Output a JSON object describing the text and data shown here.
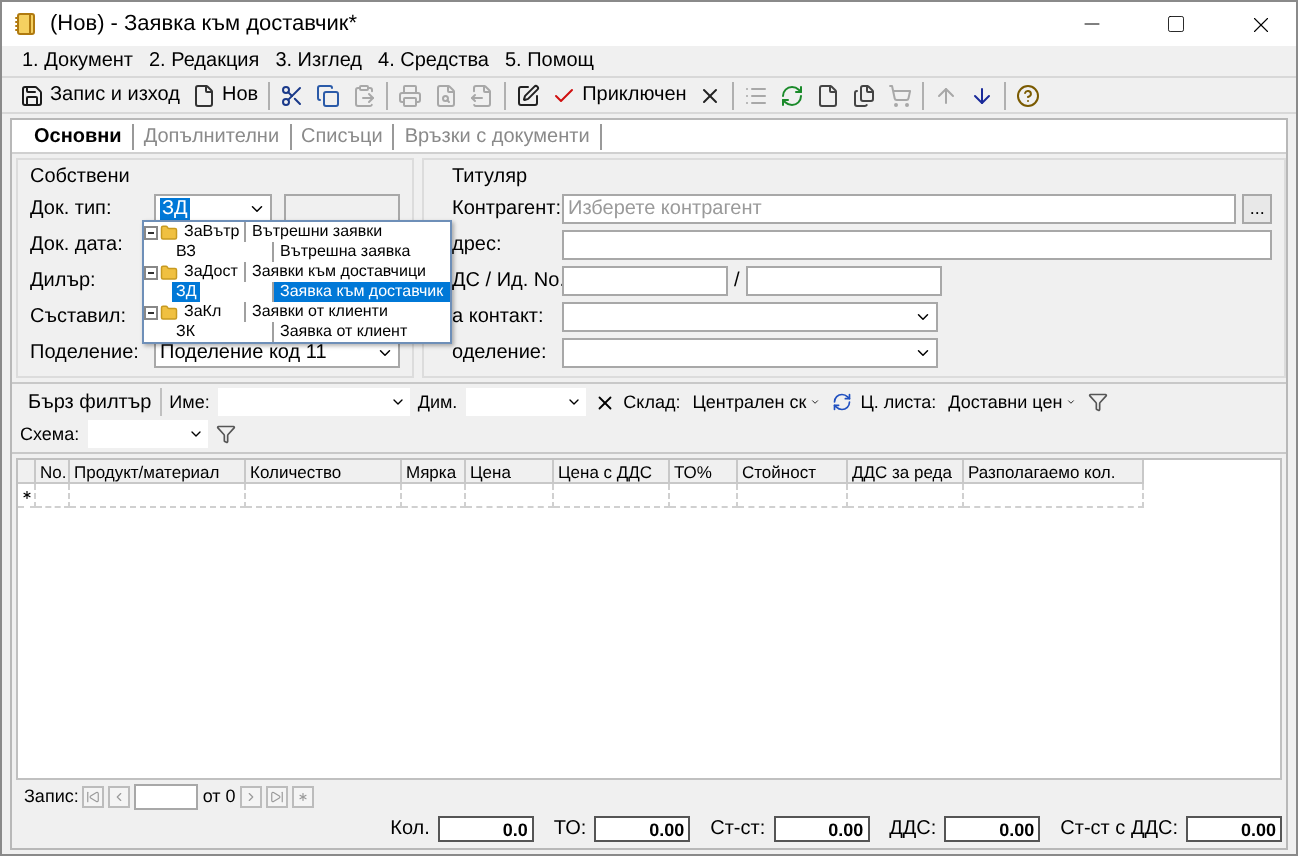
{
  "window": {
    "title": "(Нов) - Заявка към доставчик*"
  },
  "menu": [
    "1. Документ",
    "2. Редакция",
    "3. Изглед",
    "4. Средства",
    "5. Помощ"
  ],
  "toolbar": [
    {
      "kind": "save",
      "label": "Запис и изход",
      "disabled": false
    },
    {
      "kind": "new",
      "label": "Нов",
      "disabled": false
    },
    {
      "kind": "separator"
    },
    {
      "kind": "cut",
      "disabled": false
    },
    {
      "kind": "copy",
      "disabled": false
    },
    {
      "kind": "paste",
      "disabled": true
    },
    {
      "kind": "separator"
    },
    {
      "kind": "print",
      "disabled": true
    },
    {
      "kind": "preview",
      "disabled": true
    },
    {
      "kind": "export",
      "disabled": true
    },
    {
      "kind": "separator"
    },
    {
      "kind": "edit",
      "disabled": false
    },
    {
      "kind": "finish",
      "label": "Приключен",
      "disabled": false
    },
    {
      "kind": "delete",
      "disabled": false
    },
    {
      "kind": "separator"
    },
    {
      "kind": "list",
      "disabled": true
    },
    {
      "kind": "refresh",
      "disabled": false
    },
    {
      "kind": "page",
      "disabled": false
    },
    {
      "kind": "pages",
      "disabled": false
    },
    {
      "kind": "cart",
      "disabled": true
    },
    {
      "kind": "separator"
    },
    {
      "kind": "up",
      "disabled": true
    },
    {
      "kind": "down",
      "disabled": false
    },
    {
      "kind": "separator"
    },
    {
      "kind": "help",
      "disabled": false
    }
  ],
  "tabs": [
    {
      "label": "Основни",
      "selected": true
    },
    {
      "label": "Допълнителни",
      "selected": false
    },
    {
      "label": "Списъци",
      "selected": false
    },
    {
      "label": "Връзки с документи",
      "selected": false
    }
  ],
  "own": {
    "title": "Собствени",
    "doc_type": {
      "label": "Док. тип:",
      "value": "ЗД"
    },
    "labels": [
      "Док. дата:",
      "Дилър:",
      "Съставил:"
    ],
    "division": {
      "label": "Поделение:",
      "value": "Поделение код 11"
    }
  },
  "doc_type_popup": [
    {
      "code": "ЗаВътр",
      "name": "Вътрешни заявки",
      "expanded": true,
      "selected": false,
      "children": [
        {
          "code": "ВЗ",
          "name": "Вътрешна заявка",
          "selected": false
        }
      ]
    },
    {
      "code": "ЗаДост",
      "name": "Заявки към доставчици",
      "expanded": true,
      "selected": false,
      "children": [
        {
          "code": "ЗД",
          "name": "Заявка към доставчик",
          "selected": true
        }
      ]
    },
    {
      "code": "ЗаКл",
      "name": "Заявки от клиенти",
      "expanded": true,
      "selected": false,
      "children": [
        {
          "code": "ЗК",
          "name": "Заявка от клиент",
          "selected": false
        }
      ]
    }
  ],
  "titular": {
    "title": "Титуляр",
    "counterparty_label": "Контрагент:",
    "counterparty_placeholder": "Изберете контрагент",
    "browse_button": "...",
    "address_label": "дрес:",
    "vat_label": "ДС / Ид. No.",
    "vat_separator": "/",
    "contact_label": "а контакт:",
    "division_label": "оделение:"
  },
  "filter": {
    "quick_filter": "Бърз филтър",
    "name_label": "Име:",
    "dim_label": "Дим.",
    "warehouse_label": "Склад:",
    "warehouse": "Централен ск",
    "price_list_label": "Ц. листа:",
    "price_list": "Доставни цен",
    "scheme_label": "Схема:"
  },
  "grid": {
    "columns": [
      "No.",
      "Продукт/материал",
      "Количество",
      "Мярка",
      "Цена",
      "Цена с ДДС",
      "ТО%",
      "Стойност",
      "ДДС за реда",
      "Разполагаемо кол."
    ]
  },
  "record_nav": {
    "label": "Запис:",
    "of": "от 0"
  },
  "totals": [
    {
      "label": "Кол.",
      "value": "0.0"
    },
    {
      "label": "ТО:",
      "value": "0.00"
    },
    {
      "label": "Ст-ст:",
      "value": "0.00"
    },
    {
      "label": "ДДС:",
      "value": "0.00"
    },
    {
      "label": "Ст-ст с ДДС:",
      "value": "0.00"
    }
  ]
}
